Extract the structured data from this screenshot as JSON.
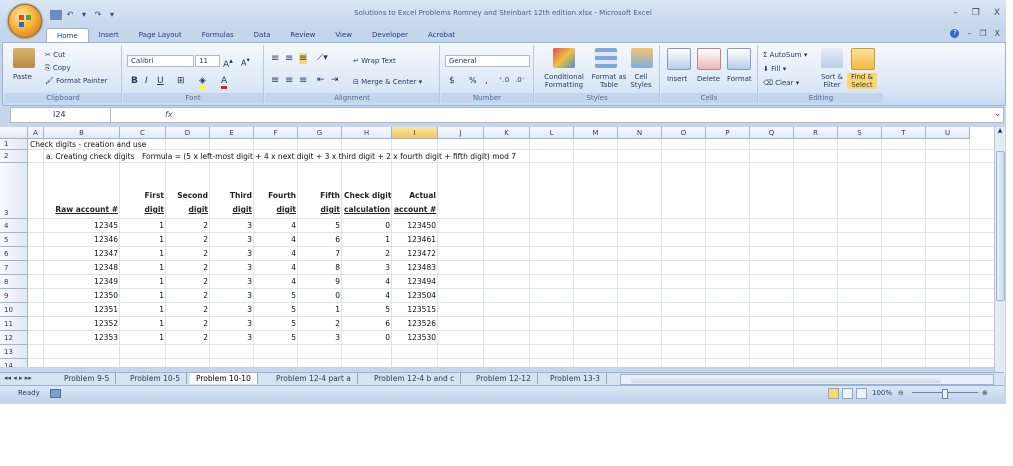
{
  "window": {
    "title": "Solutions to Excel Problems Romney and Steinbart 12th edition.xlsx - Microsoft Excel",
    "minimize": "–",
    "restore": "❐",
    "close": "X"
  },
  "ribbon_tabs": [
    "Home",
    "Insert",
    "Page Layout",
    "Formulas",
    "Data",
    "Review",
    "View",
    "Developer",
    "Acrobat"
  ],
  "ribbon": {
    "clipboard": {
      "cut": "Cut",
      "copy": "Copy",
      "paste": "Paste",
      "format_painter": "Format Painter",
      "name": "Clipboard"
    },
    "font": {
      "family": "Calibri",
      "size": "11",
      "name": "Font",
      "bold": "B",
      "italic": "I",
      "underline": "U"
    },
    "alignment": {
      "wrap_text": "Wrap Text",
      "merge_center": "Merge & Center",
      "name": "Alignment"
    },
    "number": {
      "format": "General",
      "currency": "$",
      "percent": "%",
      "comma": ",",
      "name": "Number"
    },
    "styles": {
      "conditional": "Conditional Formatting",
      "format_table": "Format as Table",
      "cell_styles": "Cell Styles",
      "name": "Styles"
    },
    "cells": {
      "insert": "Insert",
      "delete": "Delete",
      "format": "Format",
      "name": "Cells"
    },
    "editing": {
      "autosum": "AutoSum",
      "fill": "Fill",
      "clear": "Clear",
      "sort_filter": "Sort & Filter",
      "find_select": "Find & Select",
      "name": "Editing"
    }
  },
  "formula_bar": {
    "name_box": "I24",
    "fx": "fx",
    "value": ""
  },
  "columns": [
    "A",
    "B",
    "C",
    "D",
    "E",
    "F",
    "G",
    "H",
    "I",
    "J",
    "K",
    "L",
    "M",
    "N",
    "O",
    "P",
    "Q",
    "R",
    "S",
    "T",
    "U"
  ],
  "rows": [
    "1",
    "2",
    "3",
    "4",
    "5",
    "6",
    "7",
    "8",
    "9",
    "10",
    "11",
    "12",
    "13",
    "14"
  ],
  "sheet": {
    "title": "Check digits - creation and use",
    "subtitle": "a. Creating check digits",
    "formula_note": "Formula = (5 x left-most digit + 4 x next digit + 3 x third digit + 2 x fourth digit + fifth digit) mod 7",
    "headers": {
      "raw": "Raw account #",
      "first_top": "First",
      "first_bot": "digit",
      "second_top": "Second",
      "second_bot": "digit",
      "third_top": "Third",
      "third_bot": "digit",
      "fourth_top": "Fourth",
      "fourth_bot": "digit",
      "fifth_top": "Fifth",
      "fifth_bot": "digit",
      "check_top": "Check digit",
      "check_bot": "calculation",
      "actual_top": "Actual",
      "actual_bot": "account #"
    },
    "data": [
      [
        "12345",
        "1",
        "2",
        "3",
        "4",
        "5",
        "0",
        "123450"
      ],
      [
        "12346",
        "1",
        "2",
        "3",
        "4",
        "6",
        "1",
        "123461"
      ],
      [
        "12347",
        "1",
        "2",
        "3",
        "4",
        "7",
        "2",
        "123472"
      ],
      [
        "12348",
        "1",
        "2",
        "3",
        "4",
        "8",
        "3",
        "123483"
      ],
      [
        "12349",
        "1",
        "2",
        "3",
        "4",
        "9",
        "4",
        "123494"
      ],
      [
        "12350",
        "1",
        "2",
        "3",
        "5",
        "0",
        "4",
        "123504"
      ],
      [
        "12351",
        "1",
        "2",
        "3",
        "5",
        "1",
        "5",
        "123515"
      ],
      [
        "12352",
        "1",
        "2",
        "3",
        "5",
        "2",
        "6",
        "123526"
      ],
      [
        "12353",
        "1",
        "2",
        "3",
        "5",
        "3",
        "0",
        "123530"
      ]
    ]
  },
  "sheet_tabs": [
    "Problem 9-5",
    "Problem 10-5",
    "Problem 10-10",
    "Problem 12-4 part a",
    "Problem 12-4 b and c",
    "Problem 12-12",
    "Problem 13-3"
  ],
  "active_sheet": "Problem 10-10",
  "status": {
    "ready": "Ready",
    "zoom": "100%"
  },
  "colors": {
    "accent": "#15428b",
    "selected_header": "#f4c65e"
  }
}
